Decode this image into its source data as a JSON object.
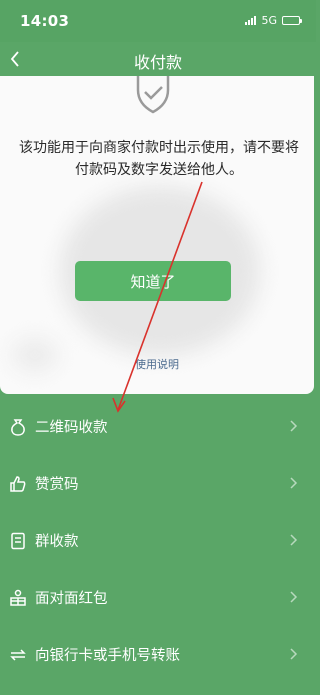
{
  "status_bar": {
    "time": "14:03",
    "network": "5G"
  },
  "nav": {
    "title": "收付款",
    "back_icon": "chevron-left-icon"
  },
  "dialog": {
    "shield_icon": "shield-check-icon",
    "notice_text": "该功能用于向商家付款时出示使用，请不要将付款码及数字发送给他人。",
    "ok_button": "知道了",
    "help_link": "使用说明"
  },
  "menu": {
    "items": [
      {
        "label": "二维码收款",
        "icon": "money-bag-icon"
      },
      {
        "label": "赞赏码",
        "icon": "thumbs-up-icon"
      },
      {
        "label": "群收款",
        "icon": "group-bill-icon"
      },
      {
        "label": "面对面红包",
        "icon": "red-packet-icon"
      },
      {
        "label": "向银行卡或手机号转账",
        "icon": "transfer-icon"
      }
    ]
  },
  "colors": {
    "background": "#5aa667",
    "button": "#59b56a",
    "link": "#4c6b8f",
    "annotation": "#d9322c"
  }
}
